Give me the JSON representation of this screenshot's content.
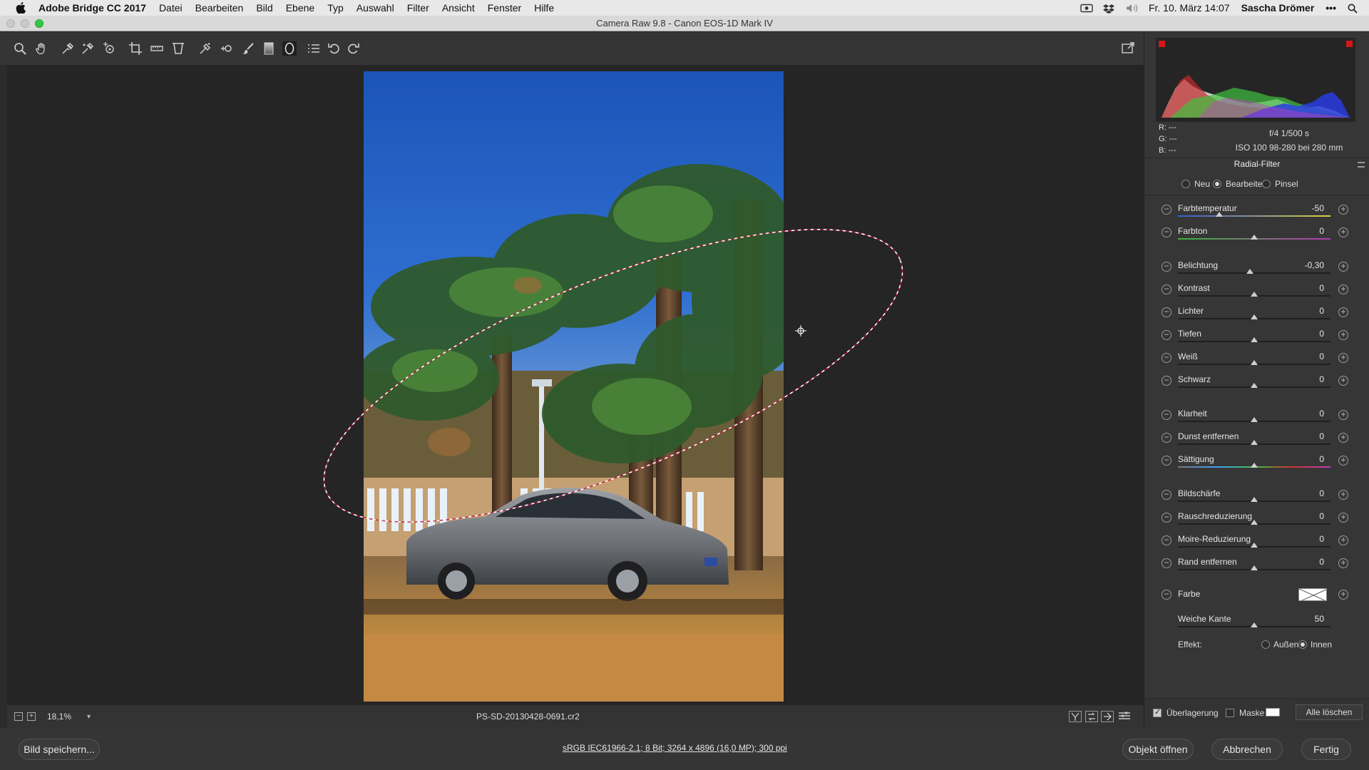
{
  "menubar": {
    "app_name": "Adobe Bridge CC 2017",
    "items": [
      "Datei",
      "Bearbeiten",
      "Bild",
      "Ebene",
      "Typ",
      "Auswahl",
      "Filter",
      "Ansicht",
      "Fenster",
      "Hilfe"
    ],
    "datetime": "Fr. 10. März 14:07",
    "user": "Sascha Drömer"
  },
  "window": {
    "title": "Camera Raw 9.8 - Canon EOS-1D Mark IV"
  },
  "toolbar": {
    "tools": [
      "zoom-icon",
      "hand-icon",
      "white-balance-icon",
      "color-sampler-icon",
      "targeted-adjustment-icon",
      "crop-icon",
      "straighten-icon",
      "transform-icon",
      "spot-removal-icon",
      "red-eye-icon",
      "adjustment-brush-icon",
      "graduated-filter-icon",
      "radial-filter-icon",
      "presets-icon",
      "rotate-ccw-icon",
      "rotate-cw-icon"
    ],
    "fullscreen_icon": "fullscreen-icon"
  },
  "status": {
    "zoom": "18,1%",
    "filename": "PS-SD-20130428-0691.cr2"
  },
  "footer": {
    "save_label": "Bild speichern...",
    "workflow": "sRGB IEC61966-2.1; 8 Bit; 3264 x 4896 (16,0 MP); 300 ppi",
    "open_label": "Objekt öffnen",
    "cancel_label": "Abbrechen",
    "done_label": "Fertig"
  },
  "panel": {
    "readout": {
      "r": "R:   ---",
      "g": "G:   ---",
      "b": "B:   ---"
    },
    "camera": {
      "aperture_shutter": "f/4     1/500 s",
      "iso_lens": "ISO 100    98-280 bei 280 mm"
    },
    "title": "Radial-Filter",
    "modes": {
      "new": "Neu",
      "edit": "Bearbeiten",
      "brush": "Pinsel"
    },
    "sliders": [
      {
        "label": "Farbtemperatur",
        "value": "-50",
        "position": 0.27
      },
      {
        "label": "Farbton",
        "value": "0",
        "position": 0.5
      },
      {
        "label": "Belichtung",
        "value": "-0,30",
        "position": 0.47
      },
      {
        "label": "Kontrast",
        "value": "0",
        "position": 0.5
      },
      {
        "label": "Lichter",
        "value": "0",
        "position": 0.5
      },
      {
        "label": "Tiefen",
        "value": "0",
        "position": 0.5
      },
      {
        "label": "Weiß",
        "value": "0",
        "position": 0.5
      },
      {
        "label": "Schwarz",
        "value": "0",
        "position": 0.5
      },
      {
        "label": "Klarheit",
        "value": "0",
        "position": 0.5
      },
      {
        "label": "Dunst entfernen",
        "value": "0",
        "position": 0.5
      },
      {
        "label": "Sättigung",
        "value": "0",
        "position": 0.5
      },
      {
        "label": "Bildschärfe",
        "value": "0",
        "position": 0.5
      },
      {
        "label": "Rauschreduzierung",
        "value": "0",
        "position": 0.5
      },
      {
        "label": "Moire-Reduzierung",
        "value": "0",
        "position": 0.5
      },
      {
        "label": "Rand entfernen",
        "value": "0",
        "position": 0.5
      }
    ],
    "color_label": "Farbe",
    "feather": {
      "label": "Weiche Kante",
      "value": "50",
      "position": 0.5
    },
    "effect": {
      "label": "Effekt:",
      "outside": "Außen",
      "inside": "Innen"
    },
    "bottom": {
      "overlay": "Überlagerung",
      "mask": "Maske",
      "clear_all": "Alle löschen"
    }
  }
}
